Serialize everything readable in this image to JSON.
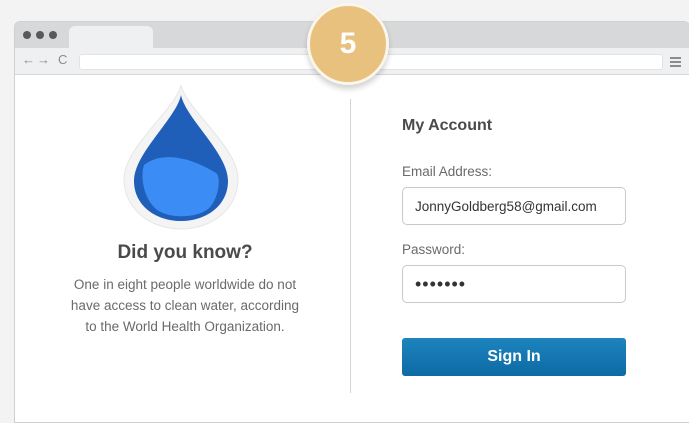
{
  "step_badge": "5",
  "browser": {
    "nav": {
      "back": "←",
      "forward": "→",
      "reload": "C"
    }
  },
  "fact": {
    "title": "Did you know?",
    "text_line1": "One in eight people worldwide do not",
    "text_line2": "have access to clean water, according",
    "text_line3": "to the World Health Organization."
  },
  "account": {
    "title": "My Account",
    "email_label": "Email Address:",
    "email_value": "JonnyGoldberg58@gmail.com",
    "password_label": "Password:",
    "password_value": "•••••••",
    "signin_label": "Sign In"
  },
  "colors": {
    "badge": "#e8c17e",
    "drop_dark": "#1f5fb9",
    "drop_light": "#3b8cf5",
    "button": "#1478b4"
  },
  "icons": [
    "water-drop-icon",
    "menu-icon"
  ]
}
